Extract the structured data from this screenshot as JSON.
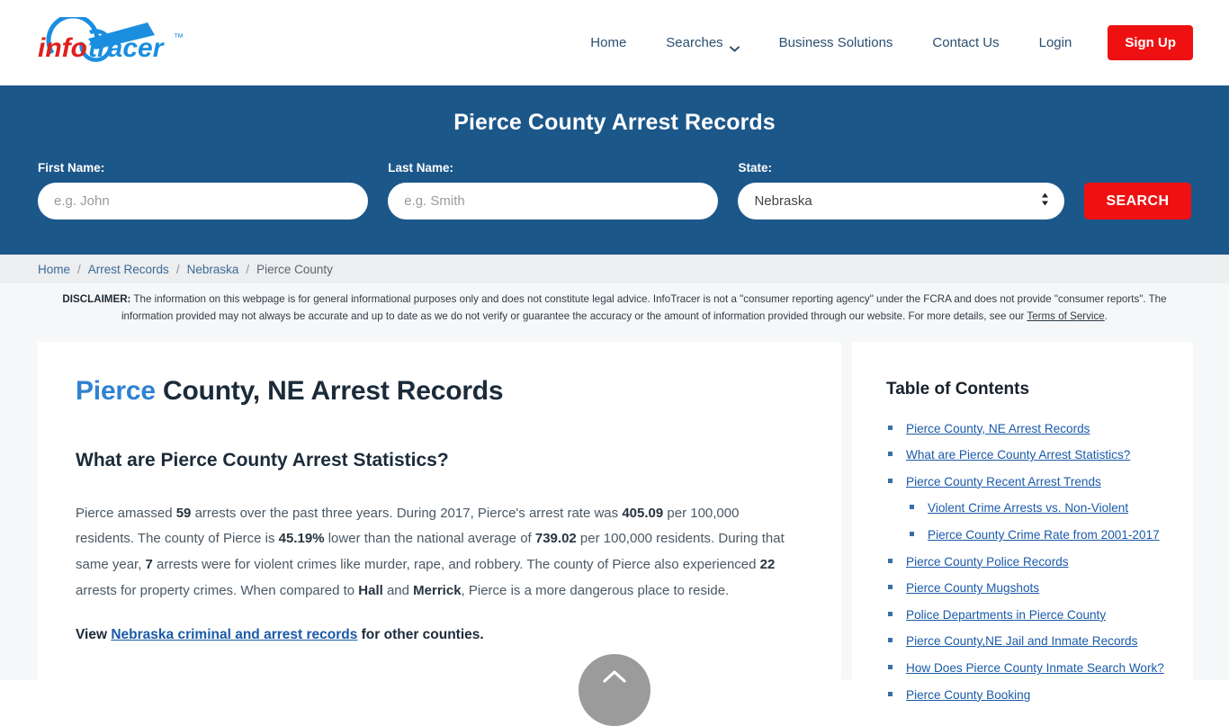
{
  "brand": {
    "logo_text_part1": "info",
    "logo_text_part2": "tracer",
    "logo_tm": "™",
    "color_red": "#e0201b",
    "color_blue": "#1b8ee0"
  },
  "nav": {
    "items": [
      {
        "label": "Home",
        "icon": ""
      },
      {
        "label": "Searches",
        "icon": "chevron-down-icon"
      },
      {
        "label": "Business Solutions",
        "icon": ""
      },
      {
        "label": "Contact Us",
        "icon": ""
      },
      {
        "label": "Login",
        "icon": ""
      }
    ],
    "signup_label": "Sign Up"
  },
  "hero": {
    "title": "Pierce County Arrest Records",
    "background_color": "#1c578a",
    "first_name_label": "First Name:",
    "first_name_placeholder": "e.g. John",
    "first_name_value": "",
    "last_name_label": "Last Name:",
    "last_name_placeholder": "e.g. Smith",
    "last_name_value": "",
    "state_label": "State:",
    "state_selected": "Nebraska",
    "state_options": [
      "Nebraska"
    ],
    "search_label": "SEARCH",
    "search_color": "#ef1111"
  },
  "breadcrumb": {
    "items": [
      "Home",
      "Arrest Records",
      "Nebraska",
      "Pierce County"
    ],
    "separator": "/"
  },
  "disclaimer": {
    "label": "DISCLAIMER:",
    "body": " The information on this webpage is for general informational purposes only and does not constitute legal advice. InfoTracer is not a \"consumer reporting agency\" under the FCRA and does not provide \"consumer reports\". The information provided may not always be accurate and up to date as we do not verify or guarantee the accuracy or the amount of information provided through our website. For more details, see our ",
    "link_text": "Terms of Service",
    "trailing": "."
  },
  "main": {
    "heading_accent": "Pierce",
    "heading_rest": " County, NE Arrest Records",
    "subheading": "What are Pierce County Arrest Statistics?",
    "paragraph_segments": [
      {
        "t": "Pierce amassed ",
        "b": false
      },
      {
        "t": "59",
        "b": true
      },
      {
        "t": " arrests over the past three years. During 2017, Pierce's arrest rate was ",
        "b": false
      },
      {
        "t": "405.09",
        "b": true
      },
      {
        "t": " per 100,000 residents. The county of Pierce is ",
        "b": false
      },
      {
        "t": "45.19%",
        "b": true
      },
      {
        "t": " lower than the national average of ",
        "b": false
      },
      {
        "t": "739.02",
        "b": true
      },
      {
        "t": " per 100,000 residents. During that same year, ",
        "b": false
      },
      {
        "t": "7",
        "b": true
      },
      {
        "t": " arrests were for violent crimes like murder, rape, and robbery. The county of Pierce also experienced ",
        "b": false
      },
      {
        "t": "22",
        "b": true
      },
      {
        "t": " arrests for property crimes. When compared to ",
        "b": false
      },
      {
        "t": "Hall",
        "b": true
      },
      {
        "t": " and ",
        "b": false
      },
      {
        "t": "Merrick",
        "b": true
      },
      {
        "t": ", Pierce is a more dangerous place to reside.",
        "b": false
      }
    ],
    "view_prefix": "View ",
    "view_link": "Nebraska criminal and arrest records",
    "view_suffix": " for other counties."
  },
  "toc": {
    "title": "Table of Contents",
    "items": [
      {
        "label": "Pierce County, NE Arrest Records",
        "sub": false
      },
      {
        "label": "What are Pierce County Arrest Statistics?",
        "sub": false
      },
      {
        "label": "Pierce County Recent Arrest Trends",
        "sub": false
      },
      {
        "label": "Violent Crime Arrests vs. Non-Violent",
        "sub": true
      },
      {
        "label": "Pierce County Crime Rate from 2001-2017",
        "sub": true
      },
      {
        "label": "Pierce County Police Records",
        "sub": false
      },
      {
        "label": "Pierce County Mugshots",
        "sub": false
      },
      {
        "label": "Police Departments in Pierce County",
        "sub": false
      },
      {
        "label": "Pierce County,NE Jail and Inmate Records",
        "sub": false
      },
      {
        "label": "How Does Pierce County Inmate Search Work?",
        "sub": false
      },
      {
        "label": "Pierce County Booking",
        "sub": false
      }
    ]
  },
  "scroll_top": {
    "icon": "chevron-up-icon"
  }
}
